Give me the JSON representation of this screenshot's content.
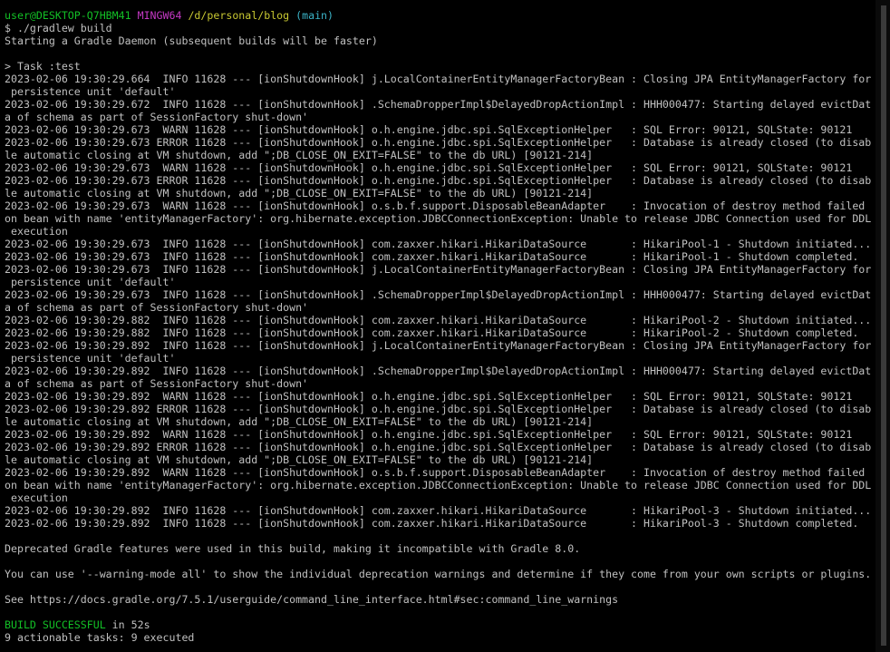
{
  "prompt": {
    "user_host": "user@DESKTOP-Q7HBM41",
    "shell": "MINGW64",
    "path": "/d/personal/blog",
    "branch": "(main)"
  },
  "command": "$ ./gradlew build",
  "output_lines": [
    "Starting a Gradle Daemon (subsequent builds will be faster)",
    "",
    "> Task :test",
    "2023-02-06 19:30:29.664  INFO 11628 --- [ionShutdownHook] j.LocalContainerEntityManagerFactoryBean : Closing JPA EntityManagerFactory for",
    " persistence unit 'default'",
    "2023-02-06 19:30:29.672  INFO 11628 --- [ionShutdownHook] .SchemaDropperImpl$DelayedDropActionImpl : HHH000477: Starting delayed evictDat",
    "a of schema as part of SessionFactory shut-down'",
    "2023-02-06 19:30:29.673  WARN 11628 --- [ionShutdownHook] o.h.engine.jdbc.spi.SqlExceptionHelper   : SQL Error: 90121, SQLState: 90121",
    "2023-02-06 19:30:29.673 ERROR 11628 --- [ionShutdownHook] o.h.engine.jdbc.spi.SqlExceptionHelper   : Database is already closed (to disab",
    "le automatic closing at VM shutdown, add \";DB_CLOSE_ON_EXIT=FALSE\" to the db URL) [90121-214]",
    "2023-02-06 19:30:29.673  WARN 11628 --- [ionShutdownHook] o.h.engine.jdbc.spi.SqlExceptionHelper   : SQL Error: 90121, SQLState: 90121",
    "2023-02-06 19:30:29.673 ERROR 11628 --- [ionShutdownHook] o.h.engine.jdbc.spi.SqlExceptionHelper   : Database is already closed (to disab",
    "le automatic closing at VM shutdown, add \";DB_CLOSE_ON_EXIT=FALSE\" to the db URL) [90121-214]",
    "2023-02-06 19:30:29.673  WARN 11628 --- [ionShutdownHook] o.s.b.f.support.DisposableBeanAdapter    : Invocation of destroy method failed",
    "on bean with name 'entityManagerFactory': org.hibernate.exception.JDBCConnectionException: Unable to release JDBC Connection used for DDL",
    " execution",
    "2023-02-06 19:30:29.673  INFO 11628 --- [ionShutdownHook] com.zaxxer.hikari.HikariDataSource       : HikariPool-1 - Shutdown initiated...",
    "2023-02-06 19:30:29.673  INFO 11628 --- [ionShutdownHook] com.zaxxer.hikari.HikariDataSource       : HikariPool-1 - Shutdown completed.",
    "2023-02-06 19:30:29.673  INFO 11628 --- [ionShutdownHook] j.LocalContainerEntityManagerFactoryBean : Closing JPA EntityManagerFactory for",
    " persistence unit 'default'",
    "2023-02-06 19:30:29.673  INFO 11628 --- [ionShutdownHook] .SchemaDropperImpl$DelayedDropActionImpl : HHH000477: Starting delayed evictDat",
    "a of schema as part of SessionFactory shut-down'",
    "2023-02-06 19:30:29.882  INFO 11628 --- [ionShutdownHook] com.zaxxer.hikari.HikariDataSource       : HikariPool-2 - Shutdown initiated...",
    "2023-02-06 19:30:29.882  INFO 11628 --- [ionShutdownHook] com.zaxxer.hikari.HikariDataSource       : HikariPool-2 - Shutdown completed.",
    "2023-02-06 19:30:29.892  INFO 11628 --- [ionShutdownHook] j.LocalContainerEntityManagerFactoryBean : Closing JPA EntityManagerFactory for",
    " persistence unit 'default'",
    "2023-02-06 19:30:29.892  INFO 11628 --- [ionShutdownHook] .SchemaDropperImpl$DelayedDropActionImpl : HHH000477: Starting delayed evictDat",
    "a of schema as part of SessionFactory shut-down'",
    "2023-02-06 19:30:29.892  WARN 11628 --- [ionShutdownHook] o.h.engine.jdbc.spi.SqlExceptionHelper   : SQL Error: 90121, SQLState: 90121",
    "2023-02-06 19:30:29.892 ERROR 11628 --- [ionShutdownHook] o.h.engine.jdbc.spi.SqlExceptionHelper   : Database is already closed (to disab",
    "le automatic closing at VM shutdown, add \";DB_CLOSE_ON_EXIT=FALSE\" to the db URL) [90121-214]",
    "2023-02-06 19:30:29.892  WARN 11628 --- [ionShutdownHook] o.h.engine.jdbc.spi.SqlExceptionHelper   : SQL Error: 90121, SQLState: 90121",
    "2023-02-06 19:30:29.892 ERROR 11628 --- [ionShutdownHook] o.h.engine.jdbc.spi.SqlExceptionHelper   : Database is already closed (to disab",
    "le automatic closing at VM shutdown, add \";DB_CLOSE_ON_EXIT=FALSE\" to the db URL) [90121-214]",
    "2023-02-06 19:30:29.892  WARN 11628 --- [ionShutdownHook] o.s.b.f.support.DisposableBeanAdapter    : Invocation of destroy method failed",
    "on bean with name 'entityManagerFactory': org.hibernate.exception.JDBCConnectionException: Unable to release JDBC Connection used for DDL",
    " execution",
    "2023-02-06 19:30:29.892  INFO 11628 --- [ionShutdownHook] com.zaxxer.hikari.HikariDataSource       : HikariPool-3 - Shutdown initiated...",
    "2023-02-06 19:30:29.892  INFO 11628 --- [ionShutdownHook] com.zaxxer.hikari.HikariDataSource       : HikariPool-3 - Shutdown completed.",
    "",
    "Deprecated Gradle features were used in this build, making it incompatible with Gradle 8.0.",
    "",
    "You can use '--warning-mode all' to show the individual deprecation warnings and determine if they come from your own scripts or plugins.",
    "",
    "See https://docs.gradle.org/7.5.1/userguide/command_line_interface.html#sec:command_line_warnings",
    ""
  ],
  "result": {
    "status": "BUILD SUCCESSFUL",
    "duration": " in 52s",
    "tasks": "9 actionable tasks: 9 executed"
  },
  "colors": {
    "background": "#000000",
    "text": "#c0c0c0",
    "user_host": "#13c126",
    "shell": "#c539c5",
    "path": "#c8c832",
    "branch": "#3bb4c8",
    "success": "#13c126"
  }
}
